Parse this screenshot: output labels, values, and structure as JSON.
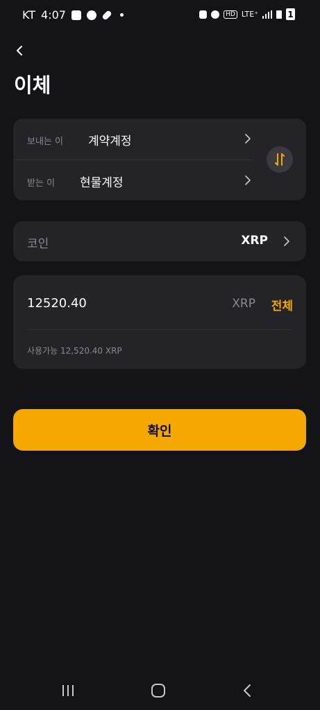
{
  "status_bar": {
    "carrier": "KT",
    "time": "4:07",
    "network": "LTE⁺",
    "hd_label": "HD",
    "battery_label": "1"
  },
  "header": {
    "title": "이체"
  },
  "transfer": {
    "from_label": "보내는 이",
    "from_value": "계약계정",
    "to_label": "받는 이",
    "to_value": "현물계정"
  },
  "coin": {
    "label": "코인",
    "value": "XRP"
  },
  "amount": {
    "value": "12520.40",
    "unit": "XRP",
    "all_label": "전체",
    "available_text": "사용가능 12,520.40 XRP"
  },
  "actions": {
    "confirm_label": "확인"
  },
  "colors": {
    "accent": "#f5a800",
    "background": "#141418",
    "card": "#232328"
  },
  "icons": {
    "back": "chevron-left-icon",
    "swap": "swap-icon",
    "chevron": "chevron-right-icon"
  }
}
